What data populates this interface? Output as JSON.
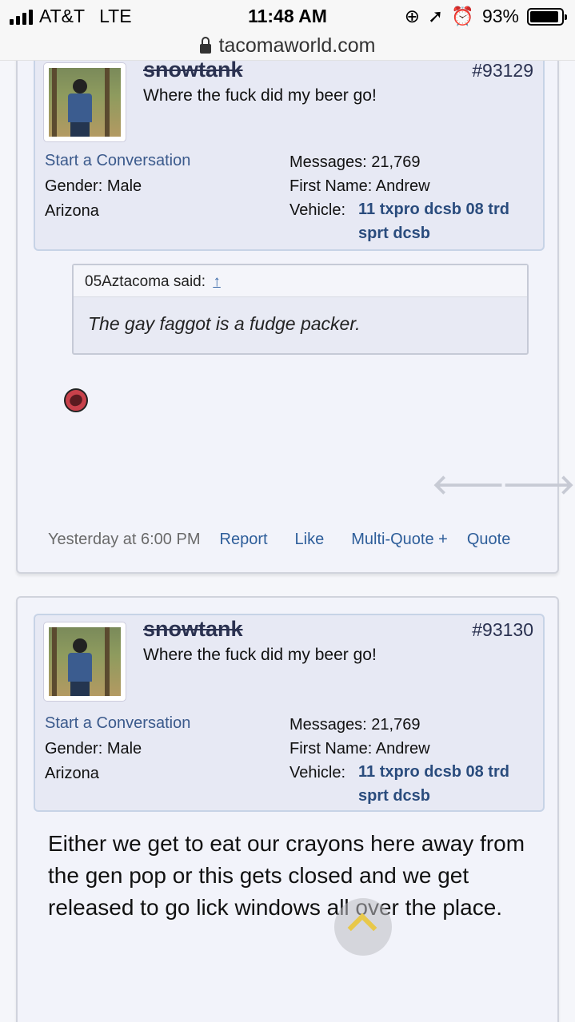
{
  "status_bar": {
    "carrier": "AT&T",
    "network": "LTE",
    "time": "11:48 AM",
    "battery": "93%",
    "battery_level": 0.93
  },
  "browser": {
    "url": "tacomaworld.com"
  },
  "posts": [
    {
      "username": "snowtank",
      "user_title": "Where the fuck did my beer go!",
      "post_number": "#93129",
      "start_conversation": "Start a Conversation",
      "gender_label": "Gender:",
      "gender": "Male",
      "location": "Arizona",
      "messages_label": "Messages:",
      "messages": "21,769",
      "first_name_label": "First Name:",
      "first_name": "Andrew",
      "vehicle_label": "Vehicle:",
      "vehicle_line1": "11 txpro dcsb 08 trd",
      "vehicle_line2": "sprt dcsb",
      "quote_author": "05Aztacoma said:",
      "quote_arrow": "↑",
      "quote_text": "The gay faggot is a fudge packer.",
      "nav_prev": "🡐",
      "nav_next": "🡒",
      "date": "Yesterday at 6:00 PM",
      "actions": {
        "report": "Report",
        "like": "Like",
        "multiquote": "Multi-Quote +",
        "quote": "Quote"
      }
    },
    {
      "username": "snowtank",
      "user_title": "Where the fuck did my beer go!",
      "post_number": "#93130",
      "start_conversation": "Start a Conversation",
      "gender_label": "Gender:",
      "gender": "Male",
      "location": "Arizona",
      "messages_label": "Messages:",
      "messages": "21,769",
      "first_name_label": "First Name:",
      "first_name": "Andrew",
      "vehicle_label": "Vehicle:",
      "vehicle_line1": "11 txpro dcsb 08 trd",
      "vehicle_line2": "sprt dcsb",
      "message": "Either we get to eat our crayons here away from the gen pop or this gets closed and we get released to go lick windows all over the place."
    }
  ]
}
